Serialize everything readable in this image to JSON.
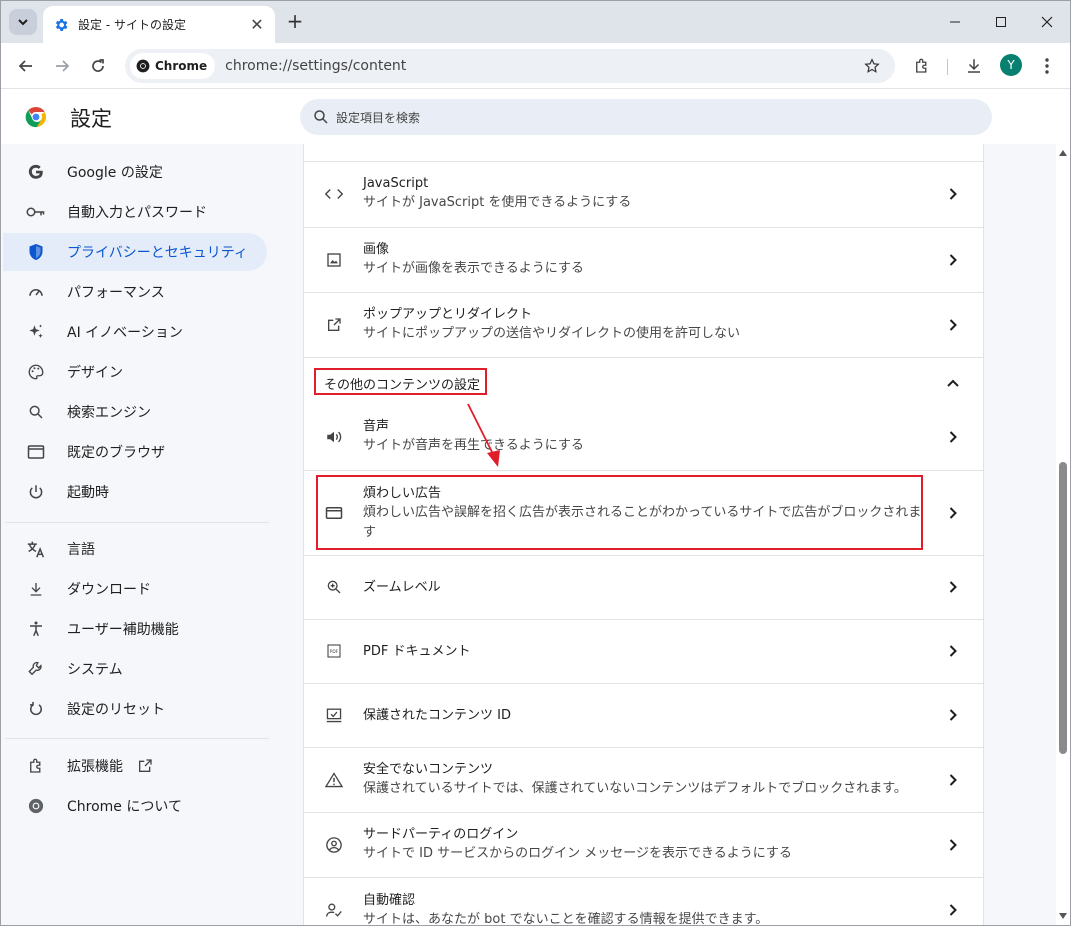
{
  "browser": {
    "tab_title": "設定 - サイトの設定",
    "chip_label": "Chrome",
    "url": "chrome://settings/content",
    "avatar_letter": "Y"
  },
  "header": {
    "title": "設定",
    "search_placeholder": "設定項目を検索"
  },
  "nav": {
    "items": [
      {
        "label": "Google の設定",
        "icon": "google-icon"
      },
      {
        "label": "自動入力とパスワード",
        "icon": "key-icon"
      },
      {
        "label": "プライバシーとセキュリティ",
        "icon": "shield-icon",
        "active": true
      },
      {
        "label": "パフォーマンス",
        "icon": "speedometer-icon"
      },
      {
        "label": "AI イノベーション",
        "icon": "sparkle-icon"
      },
      {
        "label": "デザイン",
        "icon": "palette-icon"
      },
      {
        "label": "検索エンジン",
        "icon": "search-icon"
      },
      {
        "label": "既定のブラウザ",
        "icon": "browser-window-icon"
      },
      {
        "label": "起動時",
        "icon": "power-icon"
      },
      {
        "label": "言語",
        "icon": "translate-icon"
      },
      {
        "label": "ダウンロード",
        "icon": "download-icon"
      },
      {
        "label": "ユーザー補助機能",
        "icon": "accessibility-icon"
      },
      {
        "label": "システム",
        "icon": "wrench-icon"
      },
      {
        "label": "設定のリセット",
        "icon": "reset-icon"
      },
      {
        "label": "拡張機能",
        "icon": "puzzle-icon"
      },
      {
        "label": "Chrome について",
        "icon": "chrome-icon"
      }
    ]
  },
  "content": {
    "rows": [
      {
        "title": "JavaScript",
        "sub": "サイトが JavaScript を使用できるようにする",
        "icon": "code-icon"
      },
      {
        "title": "画像",
        "sub": "サイトが画像を表示できるようにする",
        "icon": "image-icon"
      },
      {
        "title": "ポップアップとリダイレクト",
        "sub": "サイトにポップアップの送信やリダイレクトの使用を許可しない",
        "icon": "open-external-icon"
      }
    ],
    "section_label": "その他のコンテンツの設定",
    "more_rows": [
      {
        "title": "音声",
        "sub": "サイトが音声を再生できるようにする",
        "icon": "speaker-icon"
      },
      {
        "title": "煩わしい広告",
        "sub": "煩わしい広告や誤解を招く広告が表示されることがわかっているサイトで広告がブロックされます",
        "icon": "ad-window-icon"
      },
      {
        "title": "ズームレベル",
        "sub": "",
        "icon": "zoom-in-icon"
      },
      {
        "title": "PDF ドキュメント",
        "sub": "",
        "icon": "pdf-icon"
      },
      {
        "title": "保護されたコンテンツ ID",
        "sub": "",
        "icon": "protected-content-icon"
      },
      {
        "title": "安全でないコンテンツ",
        "sub": "保護されているサイトでは、保護されていないコンテンツはデフォルトでブロックされます。",
        "icon": "warning-icon"
      },
      {
        "title": "サードパーティのログイン",
        "sub": "サイトで ID サービスからのログイン メッセージを表示できるようにする",
        "icon": "account-circle-icon"
      },
      {
        "title": "自動確認",
        "sub": "サイトは、あなたが bot でないことを確認する情報を提供できます。",
        "icon": "person-check-icon"
      }
    ]
  },
  "colors": {
    "accent": "#0b57d0",
    "annotation": "#e01e2b"
  }
}
